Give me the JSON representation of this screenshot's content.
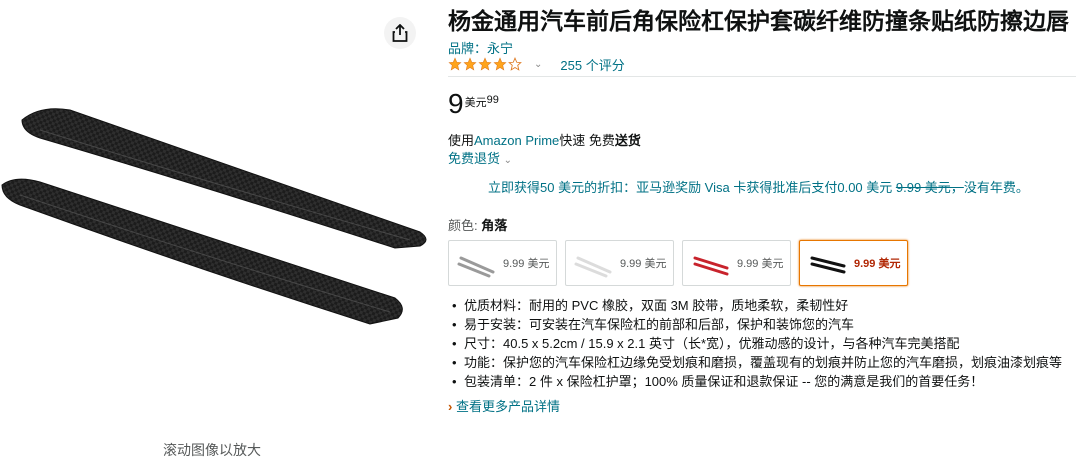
{
  "image_panel": {
    "share_icon": "share-icon",
    "zoom_hint": "滚动图像以放大"
  },
  "product": {
    "title": "杨金通用汽车前后角保险杠保护套碳纤维防撞条贴纸防擦边唇",
    "brand": "品牌：永宁",
    "rating": 4.0,
    "rating_count": "255 个评分",
    "price_whole": "9",
    "price_currency": "美元",
    "price_fraction": "99",
    "shipping_prefix": "使用",
    "shipping_link": "Amazon Prime",
    "shipping_mid": "快速 免费",
    "shipping_bold": "送货",
    "returns": "免费退货",
    "promo_text": "立即获得50 美元的折扣：亚马逊奖励 Visa 卡获得批准后支付0.00 美元",
    "promo_strike": "9.99 美元，",
    "promo_tail": "没有年费。",
    "color_label": "颜色: ",
    "color_value": "角落",
    "swatches": [
      {
        "price": "9.99 美元",
        "color": "#9a9a9a",
        "selected": false
      },
      {
        "price": "9.99 美元",
        "color": "#dcdcdc",
        "selected": false
      },
      {
        "price": "9.99 美元",
        "color": "#c8232c",
        "selected": false
      },
      {
        "price": "9.99 美元",
        "color": "#111111",
        "selected": true
      }
    ],
    "bullets": [
      "优质材料：耐用的 PVC 橡胶，双面 3M 胶带，质地柔软，柔韧性好",
      "易于安装：可安装在汽车保险杠的前部和后部，保护和装饰您的汽车",
      "尺寸：40.5 x 5.2cm / 15.9 x 2.1 英寸（长*宽），优雅动感的设计，与各种汽车完美搭配",
      "功能：保护您的汽车保险杠边缘免受划痕和磨损，覆盖现有的划痕并防止您的汽车磨损，划痕油漆划痕等",
      "包装清单：2 件 x 保险杠护罩；100% 质量保证和退款保证 -- 您的满意是我们的首要任务！"
    ],
    "see_more": "查看更多产品详情"
  },
  "colors": {
    "link": "#007185",
    "star": "#ffa41c",
    "selected_border": "#e77600"
  }
}
